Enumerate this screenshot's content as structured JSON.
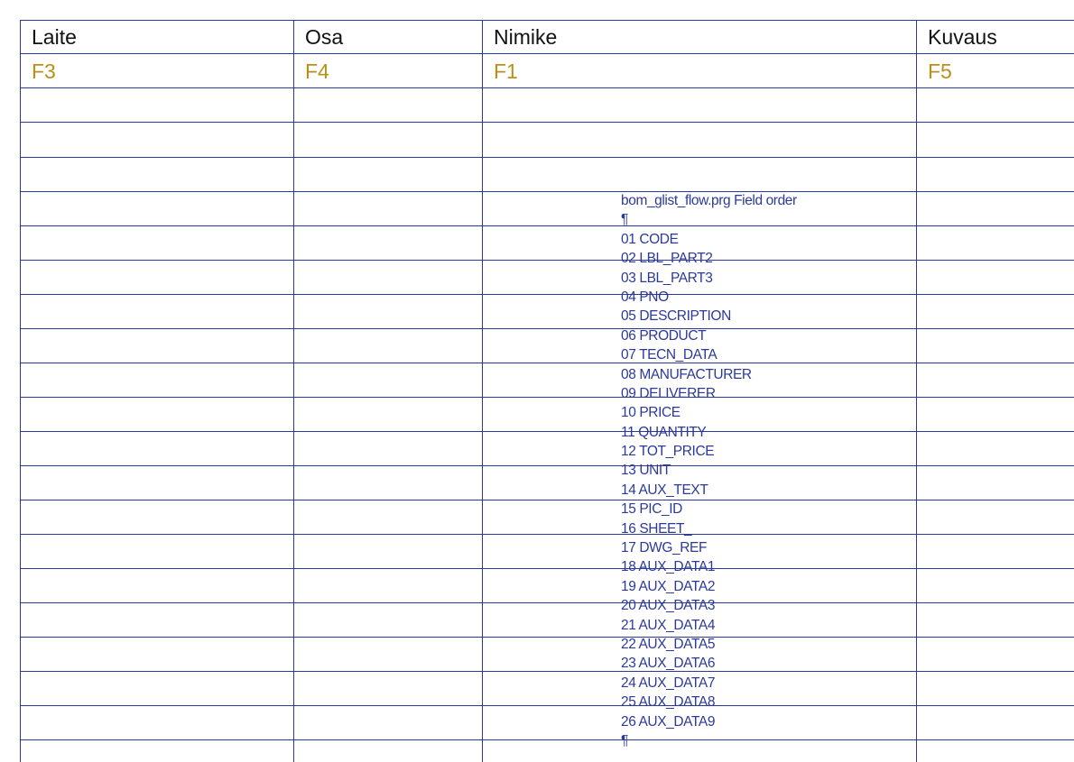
{
  "colors": {
    "grid_line": "#2b3a9a",
    "header_text": "#111111",
    "field_code": "#b8901a",
    "note_text": "#2b3a9a"
  },
  "table": {
    "headers": [
      "Laite",
      "Osa",
      "Nimike",
      "Kuvaus"
    ],
    "field_codes": [
      "F3",
      "F4",
      "F1",
      "F5"
    ]
  },
  "note": {
    "title": "bom_glist_flow.prg Field order",
    "pilcrow": "¶",
    "fields": [
      "01 CODE",
      "02 LBL_PART2",
      "03 LBL_PART3",
      "04 PNO",
      "05 DESCRIPTION",
      "06 PRODUCT",
      "07 TECN_DATA",
      "08 MANUFACTURER",
      "09 DELIVERER",
      "10 PRICE",
      "11 QUANTITY",
      "12 TOT_PRICE",
      "13 UNIT",
      "14 AUX_TEXT",
      "15 PIC_ID",
      "16 SHEET_",
      "17 DWG_REF",
      "18 AUX_DATA1",
      "19 AUX_DATA2",
      "20 AUX_DATA3",
      "21 AUX_DATA4",
      "22 AUX_DATA5",
      "23 AUX_DATA6",
      "24 AUX_DATA7",
      "25 AUX_DATA8",
      "26 AUX_DATA9"
    ],
    "end_mark": "¶"
  }
}
